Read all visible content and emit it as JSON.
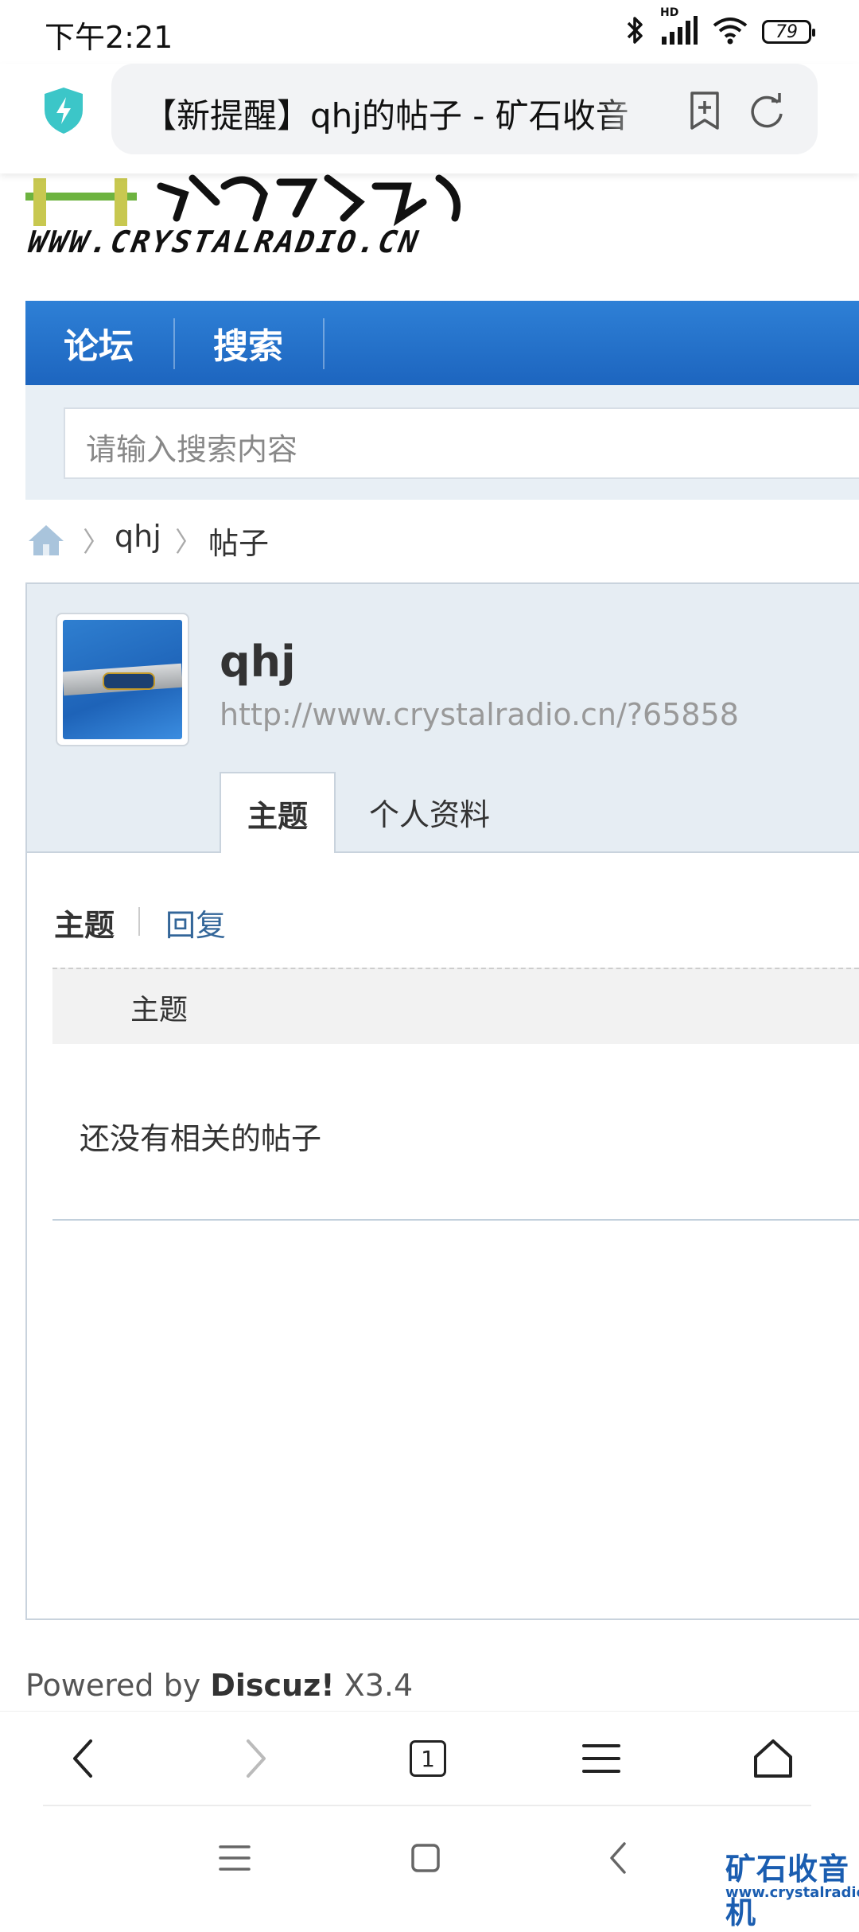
{
  "status_bar": {
    "time": "下午2:21",
    "network_label": "HD",
    "battery": "79"
  },
  "browser": {
    "address_text": "【新提醒】qhj的帖子 - 矿石收音",
    "shield_color": "#3cc6c8"
  },
  "site": {
    "logo_url_text": "WWW.CRYSTALRADIO.CN",
    "nav": [
      "论坛",
      "搜索"
    ],
    "search_placeholder": "请输入搜索内容",
    "nav_color": "#2a77cf"
  },
  "breadcrumb": [
    "qhj",
    "帖子"
  ],
  "profile": {
    "username": "qhj",
    "space_url": "http://www.crystalradio.cn/?65858",
    "tabs": [
      "主题",
      "个人资料"
    ],
    "active_tab": "主题"
  },
  "content": {
    "subtabs": [
      "主题",
      "回复"
    ],
    "table_header": "主题",
    "empty_message": "还没有相关的帖子"
  },
  "footer": {
    "powered_prefix": "Powered by",
    "brand": "Discuz!",
    "version": "X3.4"
  },
  "toolbar": {
    "tab_count": "1"
  },
  "watermark": {
    "name": "矿石收音机",
    "url": "www.crystalradio.cn"
  }
}
